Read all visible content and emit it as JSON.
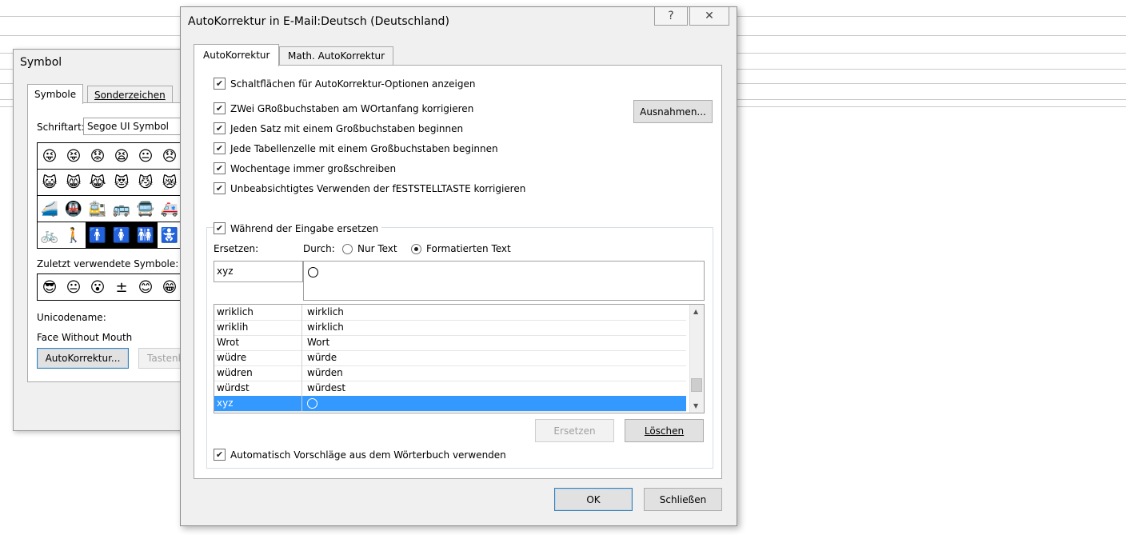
{
  "symbol_dialog": {
    "title": "Symbol",
    "tabs": [
      "Symbole",
      "Sonderzeichen"
    ],
    "font_label": "Schriftart:",
    "font_value": "Segoe UI Symbol",
    "grid": [
      [
        "😜",
        "😝",
        "😟",
        "😫",
        "😐",
        "😞"
      ],
      [
        "😺",
        "😸",
        "😹",
        "😻",
        "😼",
        "😿"
      ],
      [
        "🚄",
        "🚇",
        "🚉",
        "🚌",
        "🚍",
        "🚑"
      ],
      [
        "🚲",
        "🚶",
        "🚹",
        "🚺",
        "🚻",
        "🚼"
      ]
    ],
    "recent_label": "Zuletzt verwendete Symbole:",
    "recent": [
      "😎",
      "😐",
      "😮",
      "±",
      "😊",
      "😁"
    ],
    "unicode_label": "Unicodename:",
    "unicode_value": "Face Without Mouth",
    "autocorrect_button": "AutoKorrektur...",
    "shortcut_button_partial": "Tastenk"
  },
  "ak_dialog": {
    "title": "AutoKorrektur in E-Mail:Deutsch (Deutschland)",
    "help_icon": "?",
    "close_icon": "✕",
    "tabs": [
      "AutoKorrektur",
      "Math. AutoKorrektur"
    ],
    "options": [
      {
        "label": "Schaltflächen für AutoKorrektur-Optionen anzeigen",
        "checked": true
      },
      {
        "label": "ZWei GRoßbuchstaben am WOrtanfang korrigieren",
        "checked": true
      },
      {
        "label": "Jeden Satz mit einem Großbuchstaben beginnen",
        "checked": true
      },
      {
        "label": "Jede Tabellenzelle mit einem Großbuchstaben beginnen",
        "checked": true
      },
      {
        "label": "Wochentage immer großschreiben",
        "checked": true
      },
      {
        "label": "Unbeabsichtigtes Verwenden der fESTSTELLTASTE korrigieren",
        "checked": true
      }
    ],
    "exceptions_button": "Ausnahmen...",
    "replace_while_typing": {
      "label": "Während der Eingabe ersetzen",
      "checked": true
    },
    "replace_label": "Ersetzen:",
    "with_label": "Durch:",
    "radio_plain": "Nur Text",
    "radio_formatted": "Formatierten Text",
    "radio_selected": "Formatierten Text",
    "replace_value": "xyz",
    "entries": [
      {
        "from": "wriklich",
        "to": "wirklich"
      },
      {
        "from": "wriklih",
        "to": "wirklich"
      },
      {
        "from": "Wrot",
        "to": "Wort"
      },
      {
        "from": "wüdre",
        "to": "würde"
      },
      {
        "from": "wüdren",
        "to": "würden"
      },
      {
        "from": "würdst",
        "to": "würdest"
      },
      {
        "from": "xyz",
        "to": ""
      }
    ],
    "selected_entry": "xyz",
    "replace_button": "Ersetzen",
    "delete_button": "Löschen",
    "suggestions": {
      "label": "Automatisch Vorschläge aus dem Wörterbuch verwenden",
      "checked": true
    },
    "ok_button": "OK",
    "close_button": "Schließen"
  }
}
